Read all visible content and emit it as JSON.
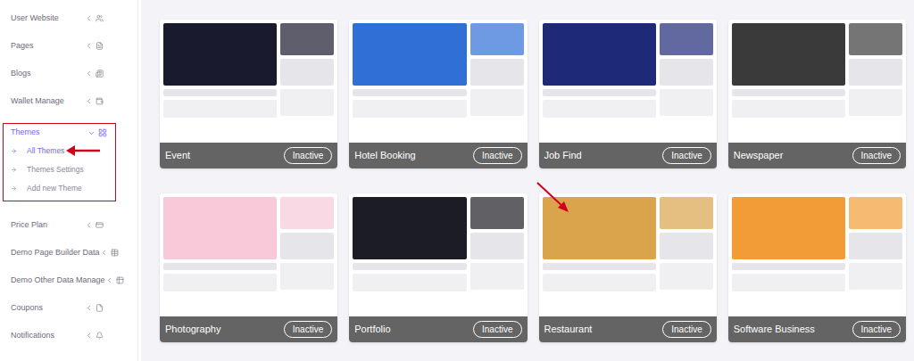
{
  "sidebar": {
    "items": [
      {
        "label": "User Website",
        "expanded": false,
        "highlighted": false
      },
      {
        "label": "Pages",
        "expanded": false,
        "highlighted": false
      },
      {
        "label": "Blogs",
        "expanded": false,
        "highlighted": false
      },
      {
        "label": "Wallet Manage",
        "expanded": false,
        "highlighted": false
      },
      {
        "label": "Themes",
        "expanded": true,
        "highlighted": true,
        "children": [
          {
            "label": "All Themes",
            "selected": true,
            "pointed": true
          },
          {
            "label": "Themes Settings",
            "selected": false,
            "pointed": false
          },
          {
            "label": "Add new Theme",
            "selected": false,
            "pointed": false
          }
        ]
      },
      {
        "label": "Price Plan",
        "expanded": false,
        "highlighted": false
      },
      {
        "label": "Demo Page Builder Data",
        "expanded": false,
        "highlighted": false
      },
      {
        "label": "Demo Other Data Manage",
        "expanded": false,
        "highlighted": false
      },
      {
        "label": "Coupons",
        "expanded": false,
        "highlighted": false
      },
      {
        "label": "Notifications",
        "expanded": false,
        "highlighted": false
      }
    ]
  },
  "themes": [
    {
      "name": "Event",
      "status": "Inactive",
      "color": "#1a1a2e",
      "pointed": false
    },
    {
      "name": "Hotel Booking",
      "status": "Inactive",
      "color": "#2f6fd6",
      "pointed": false
    },
    {
      "name": "Job Find",
      "status": "Inactive",
      "color": "#1e2a78",
      "pointed": false
    },
    {
      "name": "Newspaper",
      "status": "Inactive",
      "color": "#3a3a3a",
      "pointed": false
    },
    {
      "name": "Photography",
      "status": "Inactive",
      "color": "#f7c9d9",
      "pointed": false
    },
    {
      "name": "Portfolio",
      "status": "Inactive",
      "color": "#1c1c24",
      "pointed": false
    },
    {
      "name": "Restaurant",
      "status": "Inactive",
      "color": "#d9a44b",
      "pointed": true
    },
    {
      "name": "Software Business",
      "status": "Inactive",
      "color": "#f29c38",
      "pointed": false
    }
  ]
}
